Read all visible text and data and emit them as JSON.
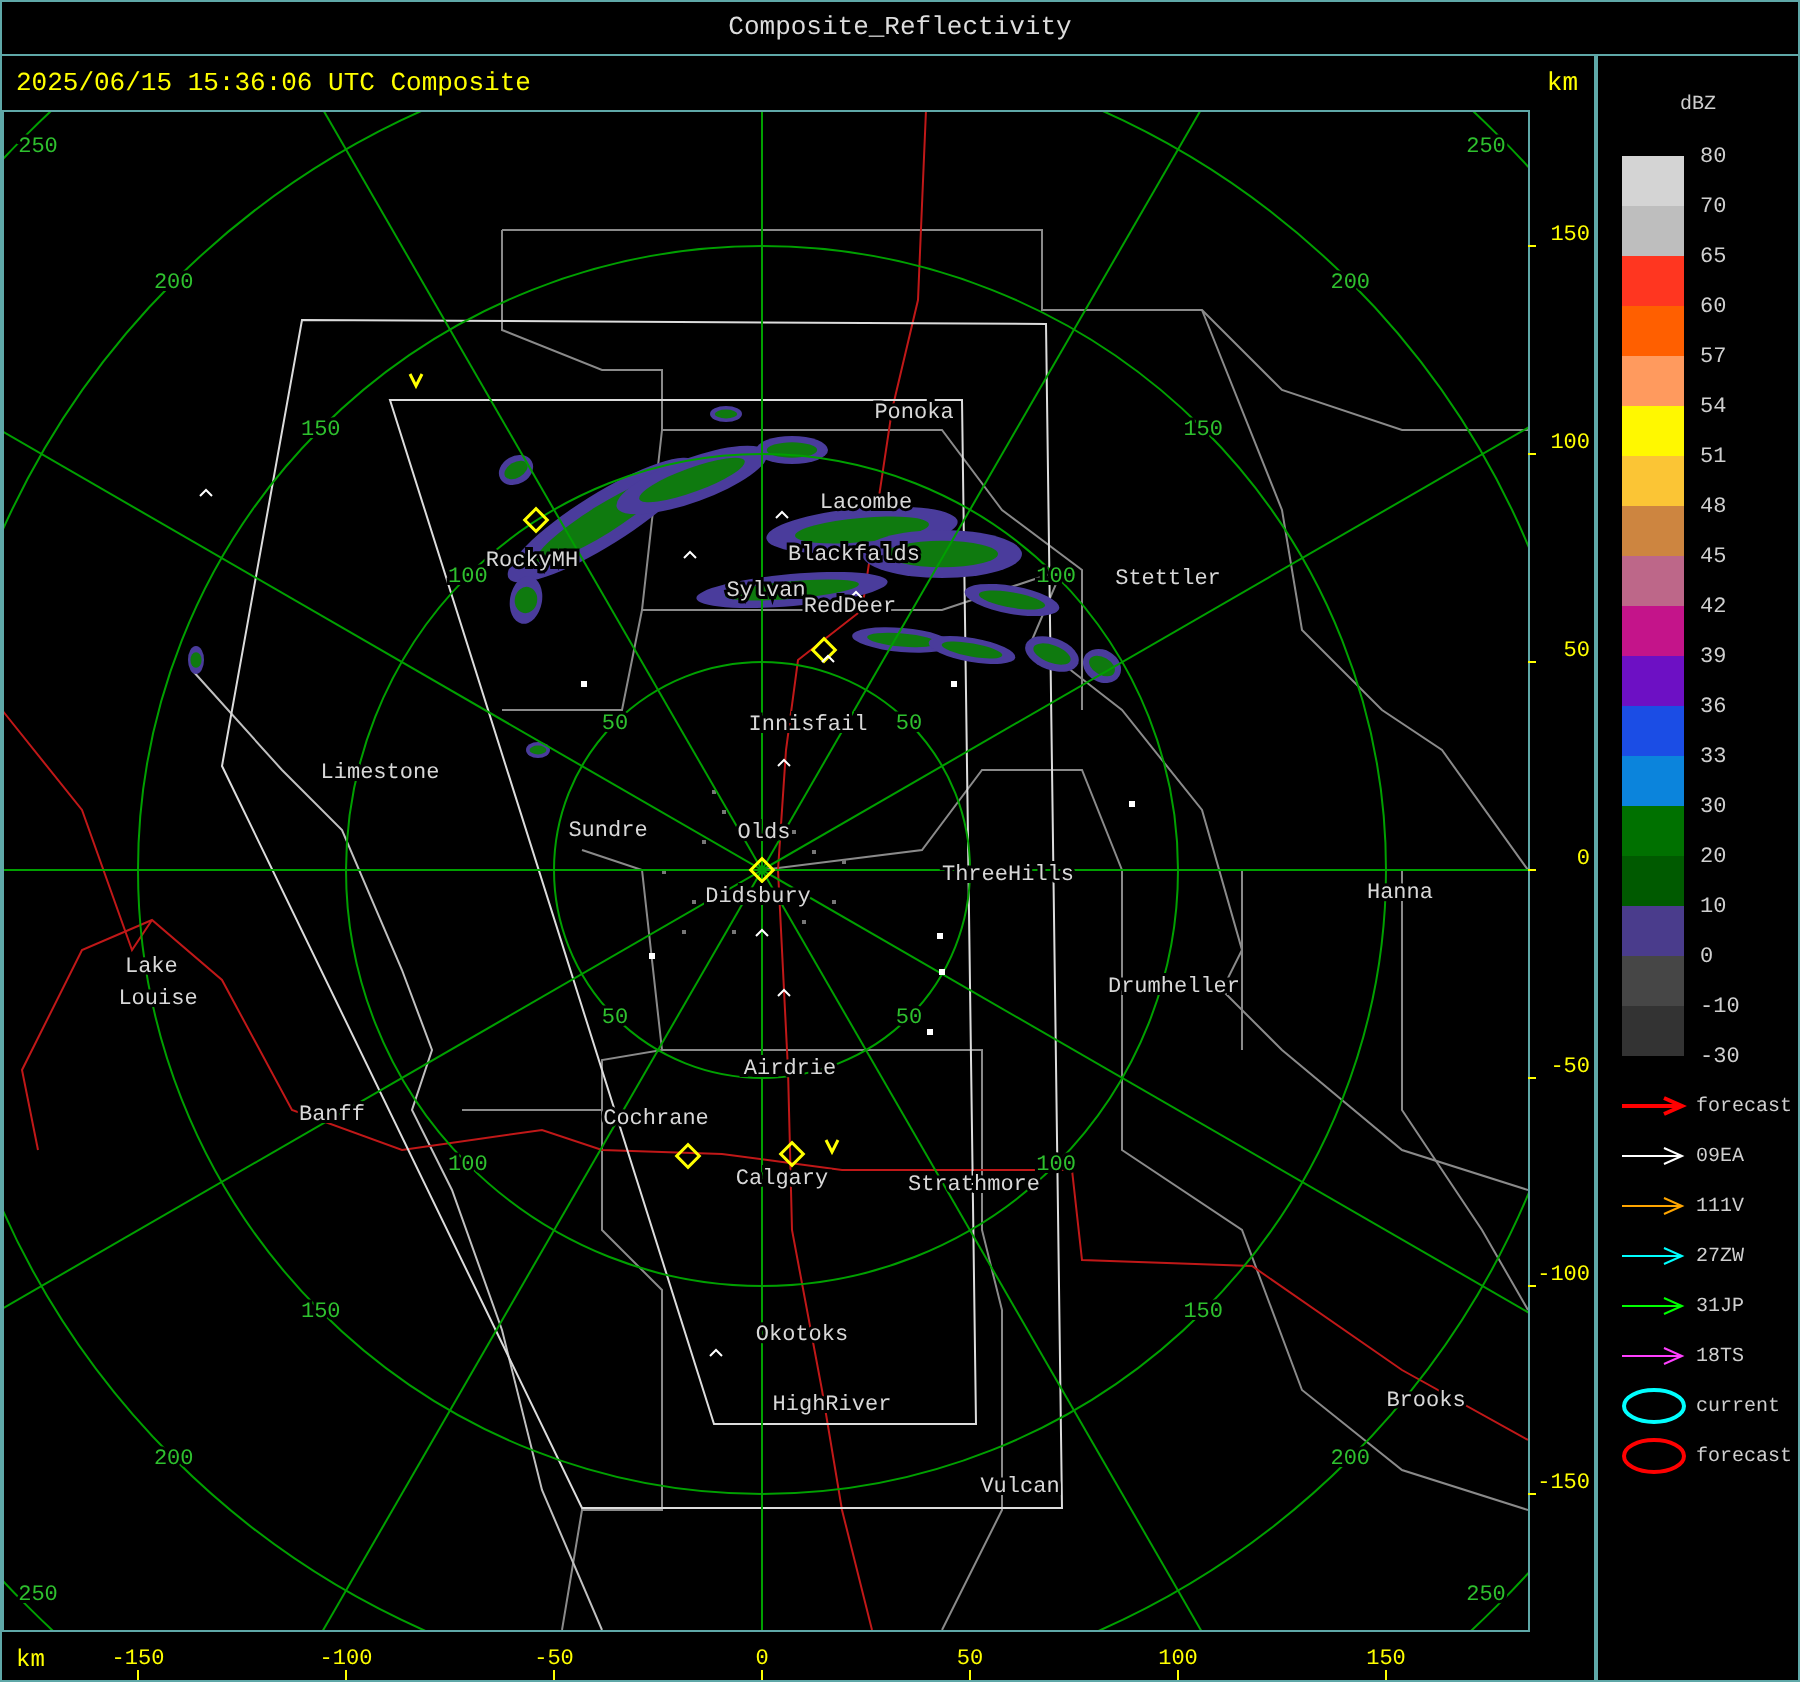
{
  "window": {
    "title": "Composite_Reflectivity"
  },
  "header": {
    "timestamp": "2025/06/15 15:36:06 UTC Composite",
    "unit": "km"
  },
  "map": {
    "rings": [
      {
        "labels": [
          "50",
          "50",
          "50",
          "50"
        ]
      },
      {
        "labels": [
          "100",
          "100",
          "100",
          "100"
        ]
      },
      {
        "labels": [
          "150",
          "150",
          "150",
          "150"
        ]
      },
      {
        "labels": [
          "200",
          "200",
          "200",
          "200"
        ]
      },
      {
        "labels": [
          "250",
          "250",
          "250",
          "250"
        ]
      }
    ],
    "cities": [
      "Ponoka",
      "Lacombe",
      "Blackfalds",
      "Sylvan",
      "RedDeer",
      "RockyMH",
      "Stettler",
      "Innisfail",
      "Limestone",
      "Sundre",
      "Olds",
      "Didsbury",
      "ThreeHills",
      "Hanna",
      "Lake Louise",
      "Drumheller",
      "Airdrie",
      "Banff",
      "Cochrane",
      "Calgary",
      "Strathmore",
      "Okotoks",
      "HighRiver",
      "Brooks",
      "Vulcan"
    ]
  },
  "y_axis": {
    "ticks": [
      "150",
      "100",
      "50",
      "0",
      "-50",
      "-100",
      "-150"
    ]
  },
  "x_axis": {
    "unit": "km",
    "ticks": [
      "-150",
      "-100",
      "-50",
      "0",
      "50",
      "100",
      "150"
    ]
  },
  "legend": {
    "title": "dBZ",
    "scale_labels": [
      "80",
      "70",
      "65",
      "60",
      "57",
      "54",
      "51",
      "48",
      "45",
      "42",
      "39",
      "36",
      "33",
      "30",
      "20",
      "10",
      "0",
      "-10",
      "-30"
    ],
    "bins": [
      {
        "color": "#d4d4d4"
      },
      {
        "color": "#bebebe"
      },
      {
        "color": "#ff3620"
      },
      {
        "color": "#ff5f00"
      },
      {
        "color": "#ff9a5e"
      },
      {
        "color": "#fff800"
      },
      {
        "color": "#fbc535"
      },
      {
        "color": "#cd8540"
      },
      {
        "color": "#bd6789"
      },
      {
        "color": "#c4148a"
      },
      {
        "color": "#6d10c4"
      },
      {
        "color": "#1b4de5"
      },
      {
        "color": "#0b84dc"
      },
      {
        "color": "#007100"
      },
      {
        "color": "#005a00"
      },
      {
        "color": "#4a3c8c"
      },
      {
        "color": "#464646"
      },
      {
        "color": "#333333"
      }
    ],
    "tracks": [
      {
        "kind": "arrow",
        "label": "forecast",
        "color": "#ff0000"
      },
      {
        "kind": "arrow",
        "label": "09EA",
        "color": "#ffffff"
      },
      {
        "kind": "arrow",
        "label": "111V",
        "color": "#ffa500"
      },
      {
        "kind": "arrow",
        "label": "27ZW",
        "color": "#00ffff"
      },
      {
        "kind": "arrow",
        "label": "31JP",
        "color": "#00ff00"
      },
      {
        "kind": "arrow",
        "label": "18TS",
        "color": "#ff40ff"
      },
      {
        "kind": "ellipse",
        "label": "current",
        "color": "#00ffff"
      },
      {
        "kind": "ellipse",
        "label": "forecast",
        "color": "#ff0000"
      }
    ]
  }
}
